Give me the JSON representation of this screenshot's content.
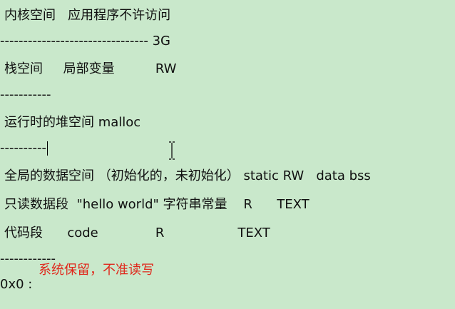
{
  "lines": {
    "l1": "内核空间   应用程序不许访问",
    "l2": "-------------------------------- 3G",
    "l3": "栈空间     局部变量          RW",
    "l4": "-----------",
    "l5": "运行时的堆空间 malloc",
    "l6": "----------",
    "l7": "全局的数据空间 （初始化的，未初始化） static RW   data bss",
    "l8": "只读数据段  \"hello world\" 字符串常量    R      TEXT",
    "l9": "代码段      code              R                  TEXT",
    "l10": "------------",
    "l11_red": "系统保留，不准读写",
    "l12": "0x0 :"
  },
  "icons": {
    "text_cursor": "ibeam-icon"
  },
  "colors": {
    "background": "#c9e8cb",
    "text": "#111111",
    "annotation_red": "#e0271b"
  }
}
